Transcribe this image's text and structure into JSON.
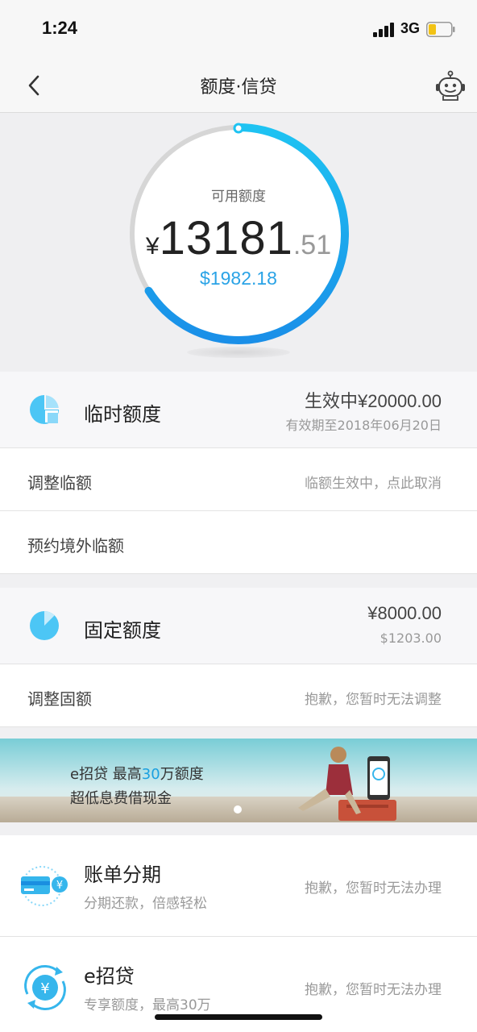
{
  "status_bar": {
    "time": "1:24",
    "network": "3G",
    "icons": [
      "signal-icon",
      "battery-icon"
    ]
  },
  "nav": {
    "title": "额度·信贷",
    "icons": [
      "back-icon",
      "assistant-robot-icon"
    ]
  },
  "credit": {
    "label": "可用额度",
    "currency_symbol": "¥",
    "amount_integer": "13181",
    "amount_decimal": ".51",
    "usd": "$1982.18",
    "ring_fraction": 0.66,
    "colors": {
      "ring_start": "#1ab8ee",
      "ring_end": "#1a8fe8",
      "track": "#d6d6d6"
    }
  },
  "temp_limit": {
    "title": "临时额度",
    "status": "生效中¥20000.00",
    "valid_until": "有效期至2018年06月20日",
    "icon": "pie-chart-icon"
  },
  "adjust_temp": {
    "label": "调整临额",
    "hint": "临额生效中，点此取消"
  },
  "overseas_temp": {
    "label": "预约境外临额"
  },
  "fixed_limit": {
    "title": "固定额度",
    "cny": "¥8000.00",
    "usd": "$1203.00",
    "icon": "pie-chart-icon"
  },
  "adjust_fixed": {
    "label": "调整固额",
    "hint": "抱歉，您暂时无法调整"
  },
  "banner": {
    "line1_prefix": "e招贷  最高",
    "line1_highlight": "30",
    "line1_suffix": "万额度",
    "line2": "超低息费借现金"
  },
  "services": [
    {
      "title": "账单分期",
      "subtitle": "分期还款，倍感轻松",
      "status": "抱歉，您暂时无法办理",
      "icon": "card-installment-icon"
    },
    {
      "title": "e招贷",
      "subtitle": "专享额度，最高30万",
      "status": "抱歉，您暂时无法办理",
      "icon": "yen-loan-icon"
    }
  ]
}
